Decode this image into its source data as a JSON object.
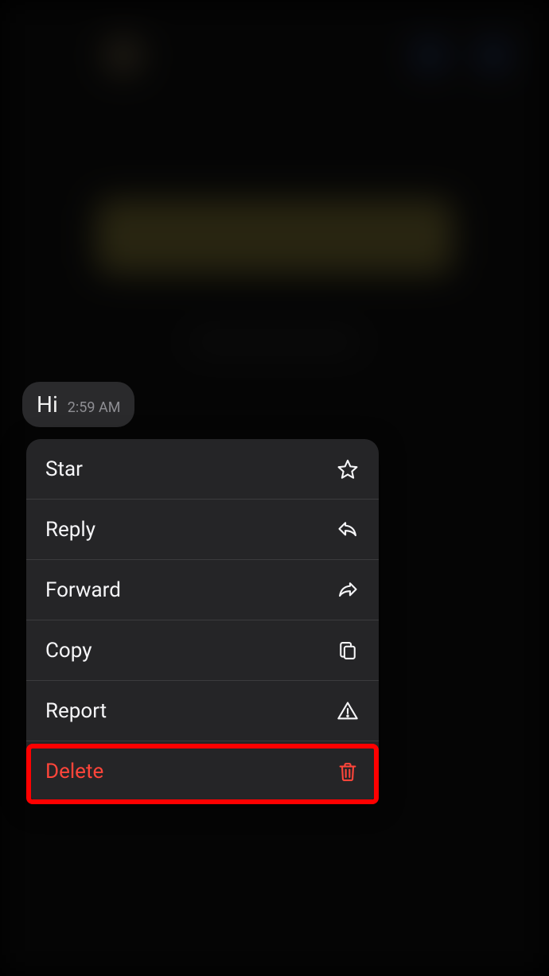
{
  "message": {
    "text": "Hi",
    "time": "2:59 AM"
  },
  "menu": {
    "items": [
      {
        "label": "Star",
        "icon": "star-icon",
        "destructive": false
      },
      {
        "label": "Reply",
        "icon": "reply-icon",
        "destructive": false
      },
      {
        "label": "Forward",
        "icon": "forward-icon",
        "destructive": false
      },
      {
        "label": "Copy",
        "icon": "copy-icon",
        "destructive": false
      },
      {
        "label": "Report",
        "icon": "report-icon",
        "destructive": false
      },
      {
        "label": "Delete",
        "icon": "trash-icon",
        "destructive": true
      }
    ]
  },
  "colors": {
    "destructive": "#ff453a",
    "text": "#f5f5f7",
    "menu_bg": "#252527",
    "bubble_bg": "#2a2a2c",
    "highlight": "#ff0000"
  }
}
